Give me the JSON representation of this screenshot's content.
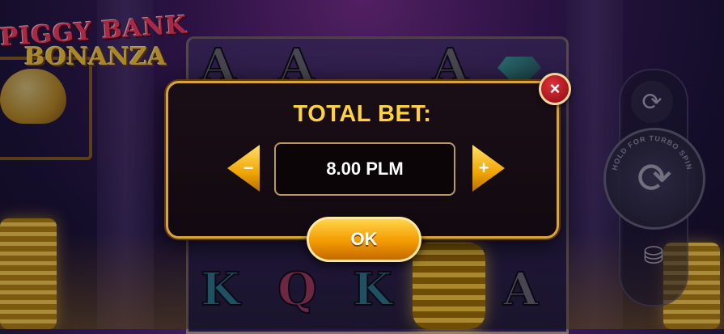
{
  "game": {
    "logo_line1": "PIGGY BANK",
    "logo_line2": "BONANZA"
  },
  "reels": {
    "visible_symbols": [
      "A",
      "A",
      "A",
      "K",
      "Q",
      "K",
      "A"
    ]
  },
  "controls": {
    "autoplay_icon": "autoplay-icon",
    "spin_icon": "spin-icon",
    "spin_hint": "HOLD FOR TURBO SPIN",
    "bet_icon": "coin-stack-plus-icon"
  },
  "bet_dialog": {
    "title": "TOTAL BET:",
    "value": "8.00 PLM",
    "decrease_label": "−",
    "increase_label": "+",
    "close_label": "×",
    "ok_label": "OK"
  },
  "colors": {
    "title_gold": "#ffd042",
    "close_red": "#c8202a",
    "button_orange": "#f39a00"
  }
}
